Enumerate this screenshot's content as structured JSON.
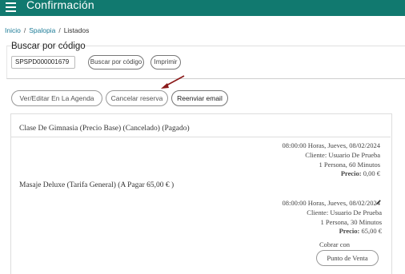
{
  "header": {
    "title": "Confirmación",
    "menu_icon": "hamburger-menu-icon",
    "color": "#11796f"
  },
  "breadcrumb": {
    "items": [
      "Inicio",
      "Spalopia",
      "Listados"
    ],
    "separator": "/"
  },
  "search": {
    "title": "Buscar por código",
    "code_value": "SPSPD000001679",
    "search_button": "Buscar por código",
    "print_button": "Imprimir"
  },
  "actions": {
    "edit": "Ver/Editar En La Agenda",
    "cancel": "Cancelar reserva",
    "email": "Reenviar email"
  },
  "services": [
    {
      "title": "Clase De Gimnasia (Precio Base) (Cancelado) (Pagado)",
      "datetime": "08:00:00 Horas, Jueves, 08/02/2024",
      "client": "Cliente: Usuario De Prueba",
      "detail": "1 Persona, 60 Minutos",
      "price_label": "Precio:",
      "price_value": "0,00 €"
    },
    {
      "title": "Masaje Deluxe (Tarifa General) (A Pagar 65,00 € )",
      "datetime": "08:00:00 Horas, Jueves, 08/02/2024",
      "client": "Cliente: Usuario De Prueba",
      "detail": "1 Persona, 30 Minutos",
      "price_label": "Precio:",
      "price_value": "65,00 €",
      "edit_icon": "pencil-icon"
    }
  ],
  "payment": {
    "label": "Cobrar con",
    "pos_button": "Punto de Venta"
  },
  "annotation": {
    "arrow_color": "#8b1a1a"
  }
}
